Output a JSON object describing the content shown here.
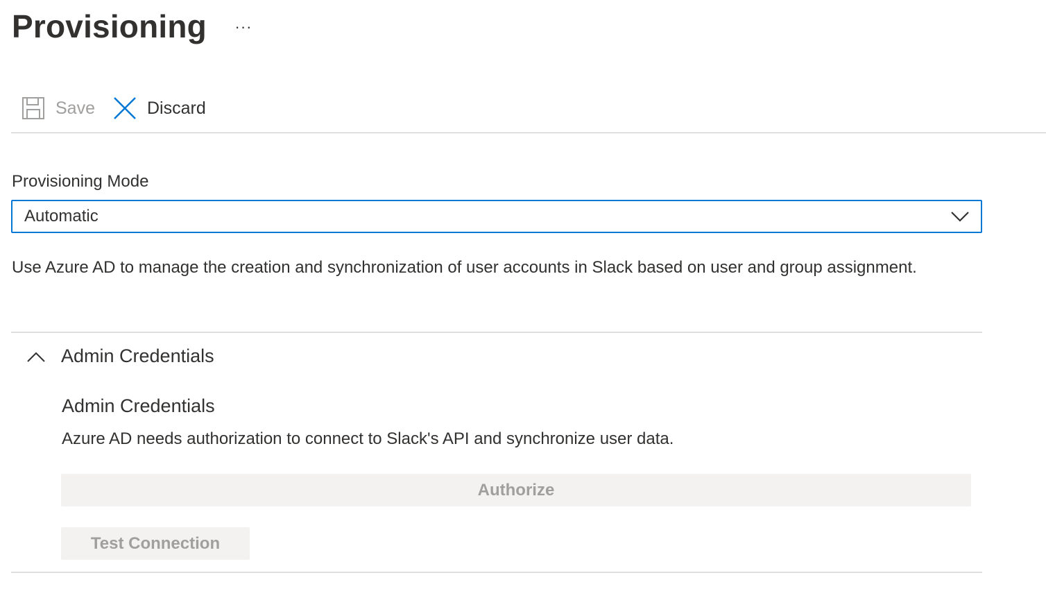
{
  "header": {
    "title": "Provisioning",
    "more_label": "···",
    "more_icon": "ellipsis-icon"
  },
  "toolbar": {
    "save_label": "Save",
    "save_icon": "save-icon",
    "discard_label": "Discard",
    "discard_icon": "close-icon"
  },
  "form": {
    "mode_label": "Provisioning Mode",
    "mode_value": "Automatic",
    "mode_description": "Use Azure AD to manage the creation and synchronization of user accounts in Slack based on user and group assignment."
  },
  "admin_section": {
    "title": "Admin Credentials",
    "expanded": true,
    "heading": "Admin Credentials",
    "description": "Azure AD needs authorization to connect to Slack's API and synchronize user data.",
    "authorize_label": "Authorize",
    "test_label": "Test Connection"
  },
  "colors": {
    "accent": "#0078d4",
    "disabled_text": "#a19f9d",
    "disabled_bg": "#f3f2f1"
  }
}
